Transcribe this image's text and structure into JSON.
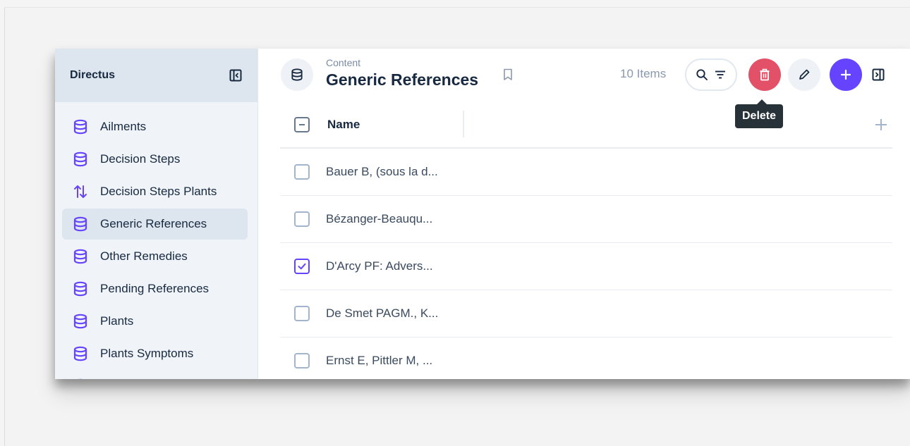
{
  "app": {
    "project_name": "Directus"
  },
  "sidebar": {
    "items": [
      {
        "label": "Ailments",
        "icon": "database-icon",
        "active": false
      },
      {
        "label": "Decision Steps",
        "icon": "database-icon",
        "active": false
      },
      {
        "label": "Decision Steps Plants",
        "icon": "import-export-icon",
        "active": false
      },
      {
        "label": "Generic References",
        "icon": "database-icon",
        "active": true
      },
      {
        "label": "Other Remedies",
        "icon": "database-icon",
        "active": false
      },
      {
        "label": "Pending References",
        "icon": "database-icon",
        "active": false
      },
      {
        "label": "Plants",
        "icon": "database-icon",
        "active": false
      },
      {
        "label": "Plants Symptoms",
        "icon": "database-icon",
        "active": false
      }
    ]
  },
  "header": {
    "breadcrumb": "Content",
    "title": "Generic References",
    "item_count": "10 Items",
    "tooltip": "Delete"
  },
  "table": {
    "column_header": "Name",
    "rows": [
      {
        "name": "Bauer B, (sous la d...",
        "checked": false
      },
      {
        "name": "Bézanger-Beauqu...",
        "checked": false
      },
      {
        "name": "D'Arcy PF: Advers...",
        "checked": true
      },
      {
        "name": "De Smet PAGM., K...",
        "checked": false
      },
      {
        "name": "Ernst E, Pittler M, ...",
        "checked": false
      }
    ]
  },
  "colors": {
    "accent": "#6644ff",
    "danger": "#e35169",
    "sidebar_bg": "#f0f4f9",
    "sidebar_header_bg": "#dde5ee",
    "text_primary": "#172940",
    "tooltip_bg": "#263238"
  }
}
